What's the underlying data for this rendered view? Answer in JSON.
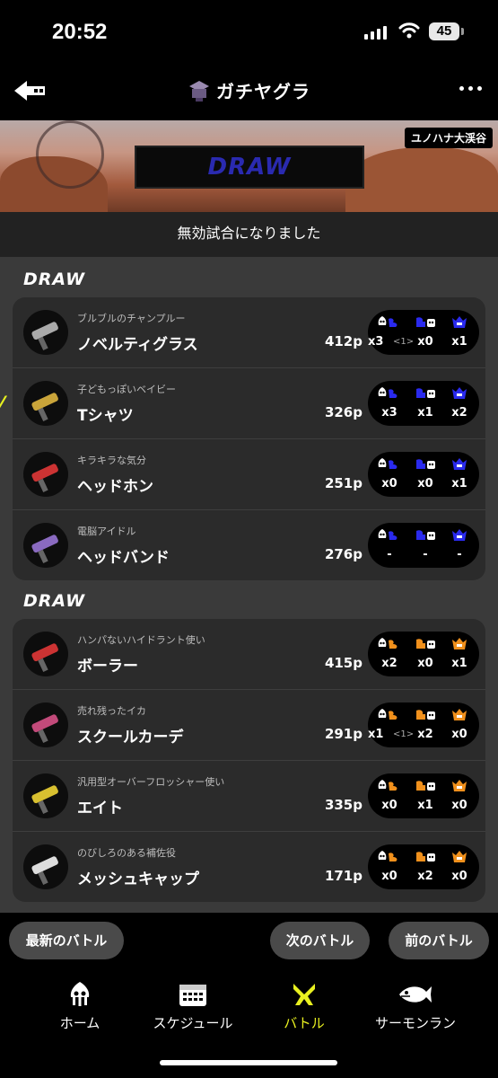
{
  "status_bar": {
    "time": "20:52",
    "battery": "45"
  },
  "nav": {
    "title": "ガチヤグラ",
    "back_icon": "back-arrow-icon",
    "mode_icon": "tower-control-icon",
    "more_icon": "more-dots-icon"
  },
  "banner": {
    "stage": "ユノハナ大渓谷",
    "result": "DRAW"
  },
  "notice": "無効試合になりました",
  "teams": [
    {
      "header": "DRAW",
      "players": [
        {
          "title": "ブルブルのチャンプルー",
          "name": "ノベルティグラス",
          "points": "412p",
          "kills": "x3",
          "assist": "<1>",
          "specials": "x0",
          "special_uses": "x1",
          "icon_color": "#2a2aee"
        },
        {
          "title": "子どもっぽいベイビー",
          "name": "Tシャツ",
          "points": "326p",
          "kills": "x3",
          "assist": "",
          "specials": "x1",
          "special_uses": "x2",
          "icon_color": "#2a2aee"
        },
        {
          "title": "キラキラな気分",
          "name": "ヘッドホン",
          "points": "251p",
          "kills": "x0",
          "assist": "",
          "specials": "x0",
          "special_uses": "x1",
          "icon_color": "#2a2aee"
        },
        {
          "title": "電脳アイドル",
          "name": "ヘッドバンド",
          "points": "276p",
          "kills": "-",
          "assist": "",
          "specials": "-",
          "special_uses": "-",
          "icon_color": "#2a2aee"
        }
      ]
    },
    {
      "header": "DRAW",
      "players": [
        {
          "title": "ハンパないハイドラント使い",
          "name": "ボーラー",
          "points": "415p",
          "kills": "x2",
          "assist": "",
          "specials": "x0",
          "special_uses": "x1",
          "icon_color": "#f0901c"
        },
        {
          "title": "売れ残ったイカ",
          "name": "スクールカーデ",
          "points": "291p",
          "kills": "x1",
          "assist": "<1>",
          "specials": "x2",
          "special_uses": "x0",
          "icon_color": "#f0901c"
        },
        {
          "title": "汎用型オーバーフロッシャー使い",
          "name": "エイト",
          "points": "335p",
          "kills": "x0",
          "assist": "",
          "specials": "x1",
          "special_uses": "x0",
          "icon_color": "#f0901c"
        },
        {
          "title": "のびしろのある補佐役",
          "name": "メッシュキャップ",
          "points": "171p",
          "kills": "x0",
          "assist": "",
          "specials": "x2",
          "special_uses": "x0",
          "icon_color": "#f0901c"
        }
      ]
    }
  ],
  "actions": {
    "latest": "最新のバトル",
    "next": "次のバトル",
    "prev": "前のバトル"
  },
  "tabs": [
    {
      "label": "ホーム",
      "icon": "squid-home-icon"
    },
    {
      "label": "スケジュール",
      "icon": "calendar-icon"
    },
    {
      "label": "バトル",
      "icon": "battle-icon",
      "active": true
    },
    {
      "label": "サーモンラン",
      "icon": "salmon-icon"
    }
  ],
  "colors": {
    "accent": "#e8f020",
    "blue_team": "#2a2aee",
    "orange_team": "#f0901c"
  }
}
